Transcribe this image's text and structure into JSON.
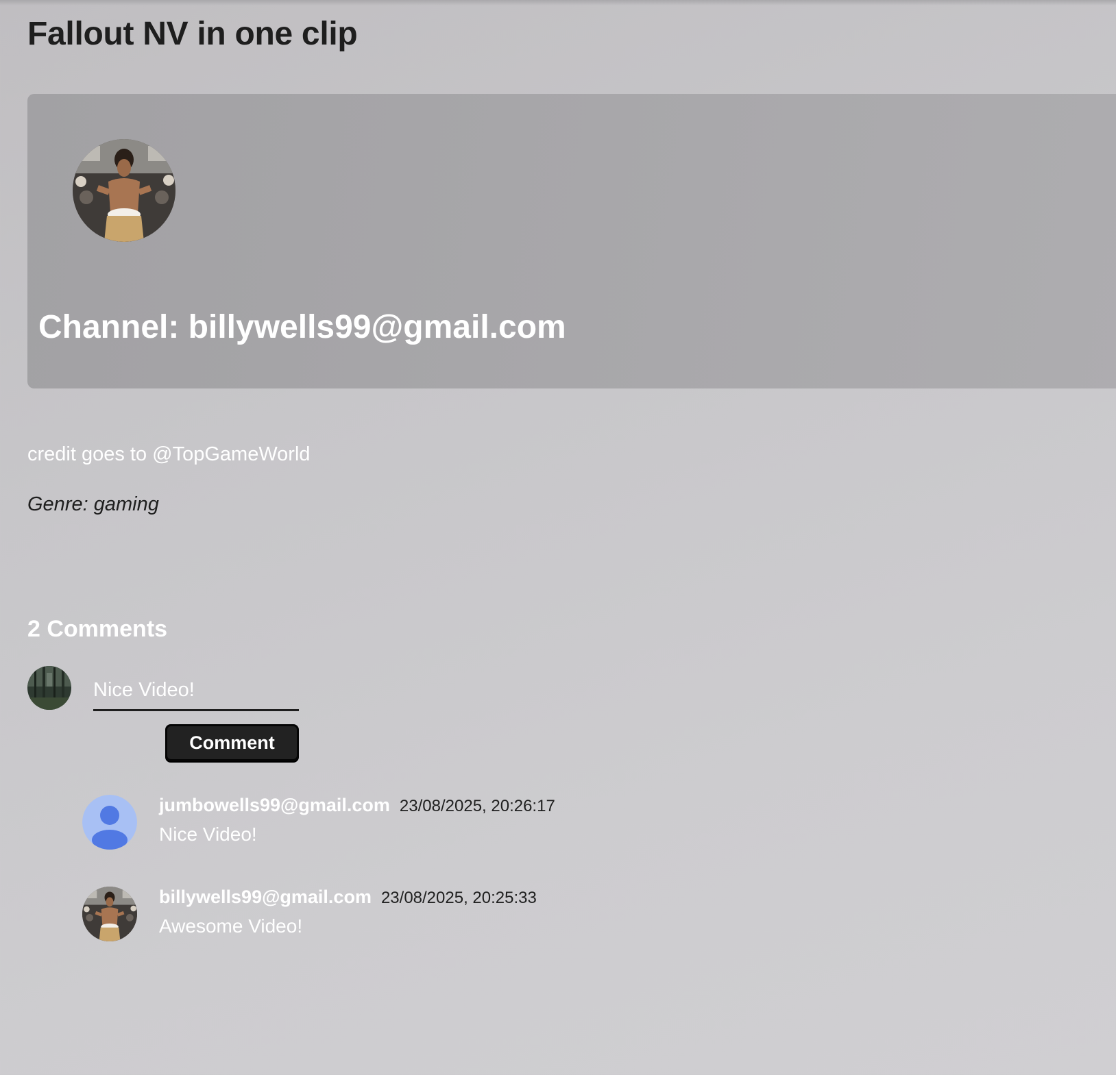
{
  "video": {
    "title": "Fallout NV in one clip",
    "description": "credit goes to @TopGameWorld",
    "genre": "Genre: gaming"
  },
  "channel": {
    "label": "Channel: billywells99@gmail.com"
  },
  "comments": {
    "heading": "2 Comments",
    "input_value": "Nice Video!",
    "button_label": "Comment",
    "items": [
      {
        "author": "jumbowells99@gmail.com",
        "time": "23/08/2025, 20:26:17",
        "text": "Nice Video!"
      },
      {
        "author": "billywells99@gmail.com",
        "time": "23/08/2025, 20:25:33",
        "text": "Awesome Video!"
      }
    ]
  },
  "colors": {
    "card_background": "#a8a7aa",
    "button_background": "#222222",
    "default_avatar_bg": "#a8c0f4",
    "default_avatar_fg": "#5179e3"
  },
  "icons": {
    "channel_avatar": "person-photo-avatar",
    "current_user_avatar": "forest-photo-avatar",
    "comment_1_avatar": "default-person-icon",
    "comment_2_avatar": "person-photo-avatar"
  }
}
